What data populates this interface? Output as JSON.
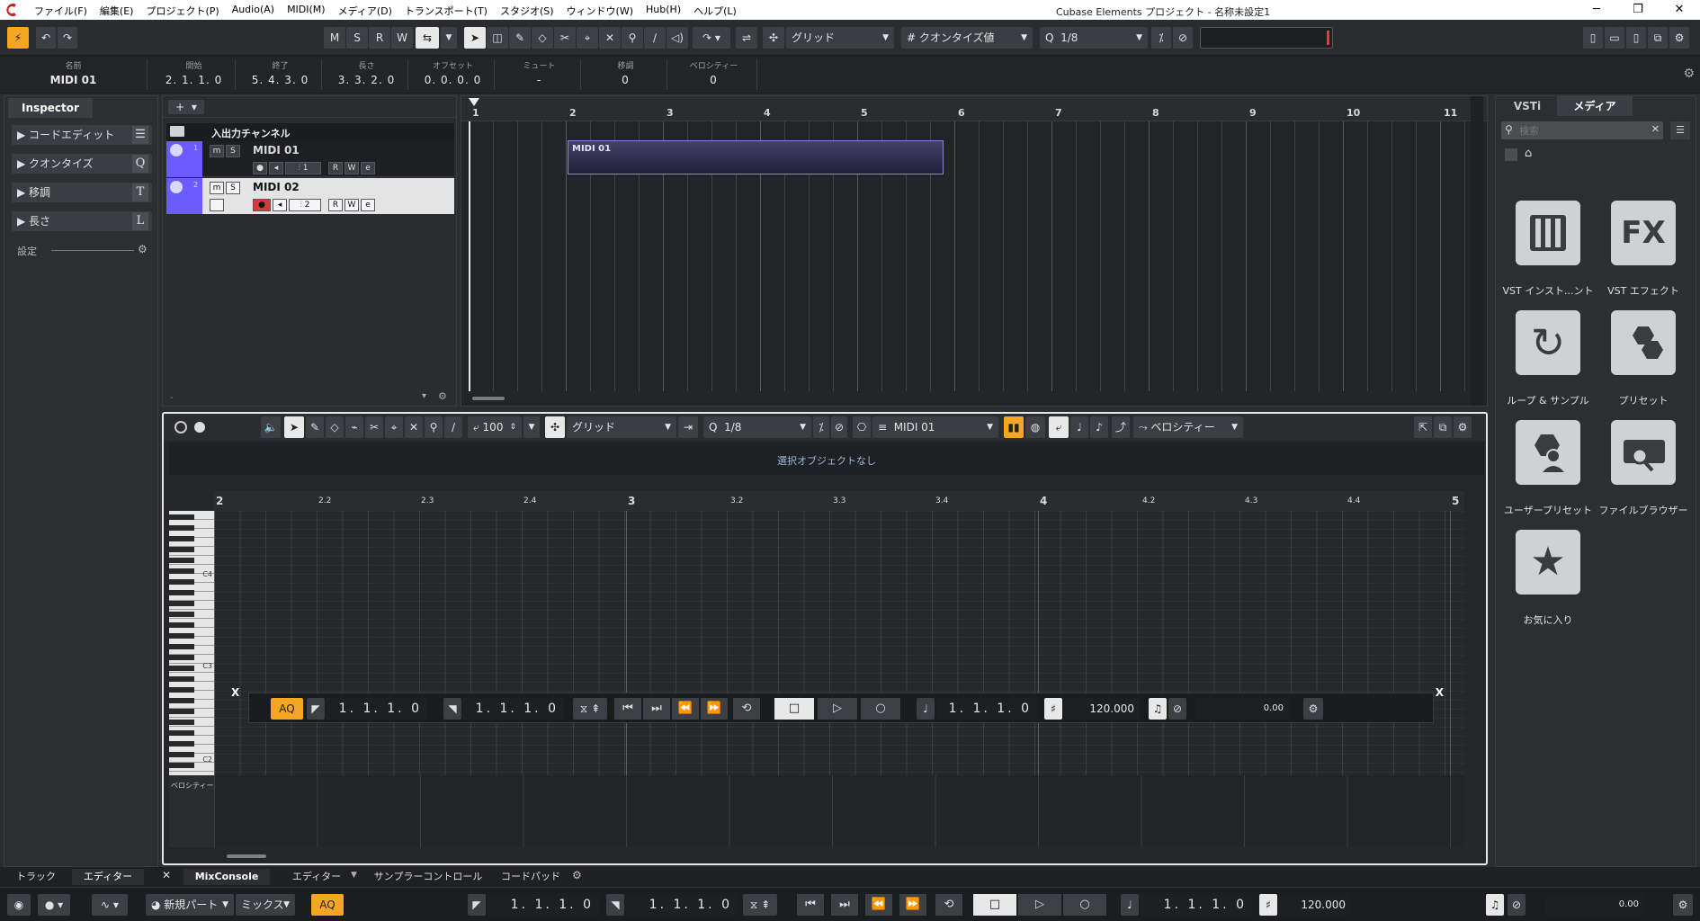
{
  "menubar": {
    "items": [
      "ファイル(F)",
      "編集(E)",
      "プロジェクト(P)",
      "Audio(A)",
      "MIDI(M)",
      "メディア(D)",
      "トランスポート(T)",
      "スタジオ(S)",
      "ウィンドウ(W)",
      "Hub(H)",
      "ヘルプ(L)"
    ],
    "title": "Cubase Elements プロジェクト - 名称未設定1"
  },
  "toolbar": {
    "msrw": [
      "M",
      "S",
      "R",
      "W"
    ],
    "snap_type": "グリッド",
    "grid_type": "クオンタイズ値",
    "quantize": "1/8"
  },
  "infoline": {
    "columns": [
      {
        "label": "名前",
        "value": "MIDI 01"
      },
      {
        "label": "開始",
        "value": "2. 1. 1.  0"
      },
      {
        "label": "終了",
        "value": "5. 4. 3.  0"
      },
      {
        "label": "長さ",
        "value": "3. 3. 2.  0"
      },
      {
        "label": "オフセット",
        "value": "0. 0. 0.  0"
      },
      {
        "label": "ミュート",
        "value": "-"
      },
      {
        "label": "移調",
        "value": "0"
      },
      {
        "label": "ベロシティー",
        "value": "0"
      }
    ]
  },
  "inspector": {
    "tab": "Inspector",
    "sections": [
      {
        "label": "コードエディット",
        "key": "☰"
      },
      {
        "label": "クオンタイズ",
        "key": "Q"
      },
      {
        "label": "移調",
        "key": "T"
      },
      {
        "label": "長さ",
        "key": "L"
      }
    ],
    "settings_label": "設定"
  },
  "tracklist": {
    "folder_label": "入出力チャンネル",
    "tracks": [
      {
        "name": "MIDI 01",
        "number": "1",
        "channel": "1"
      },
      {
        "name": "MIDI 02",
        "number": "2",
        "channel": "2"
      }
    ]
  },
  "arranger": {
    "ruler": [
      "1",
      "2",
      "3",
      "4",
      "5",
      "6",
      "7",
      "8",
      "9",
      "10",
      "11"
    ],
    "event_name": "MIDI 01"
  },
  "editor": {
    "velocity": "100",
    "snap_type": "グリッド",
    "quantize": "1/8",
    "part": "MIDI 01",
    "controller": "ベロシティー",
    "status": "選択オブジェクトなし",
    "ruler": [
      "2",
      "2.2",
      "2.3",
      "2.4",
      "3",
      "3.2",
      "3.3",
      "3.4",
      "4",
      "4.2",
      "4.3",
      "4.4",
      "5"
    ],
    "keys": [
      "C4",
      "C3",
      "C2"
    ],
    "velocity_lane_label": "ベロシティー"
  },
  "transport": {
    "aq": "AQ",
    "left_locator": "1. 1. 1.  0",
    "right_locator": "1. 1. 1.  0",
    "position": "1. 1. 1.  0",
    "tempo": "120.000",
    "level": "0.00"
  },
  "mediabay": {
    "tabs": [
      "VSTi",
      "メディア"
    ],
    "search_placeholder": "検索",
    "tiles": [
      {
        "label": "VST インスト...ント",
        "icon": "piano-icon"
      },
      {
        "label": "VST エフェクト",
        "icon": "fx-icon"
      },
      {
        "label": "ループ & サンプル",
        "icon": "loop-icon"
      },
      {
        "label": "プリセット",
        "icon": "hexagons-icon"
      },
      {
        "label": "ユーザープリセット",
        "icon": "user-preset-icon"
      },
      {
        "label": "ファイルブラウザー",
        "icon": "file-browser-icon"
      },
      {
        "label": "お気に入り",
        "icon": "star-icon"
      }
    ]
  },
  "lowerzone_tabs": {
    "left": [
      "トラック",
      "エディター"
    ],
    "main": [
      "MixConsole",
      "エディター",
      "サンプラーコントロール",
      "コードパッド"
    ]
  },
  "statusbar": {
    "new_part": "新規パート",
    "mix": "ミックス",
    "aq": "AQ",
    "left_locator": "1. 1. 1.  0",
    "right_locator": "1. 1. 1.  0",
    "position": "1. 1. 1.  0",
    "tempo": "120.000",
    "level": "0.00"
  },
  "colors": {
    "accent_orange": "#f5a623",
    "track_purple": "#6a5cff",
    "record_red": "#d83a3a"
  }
}
